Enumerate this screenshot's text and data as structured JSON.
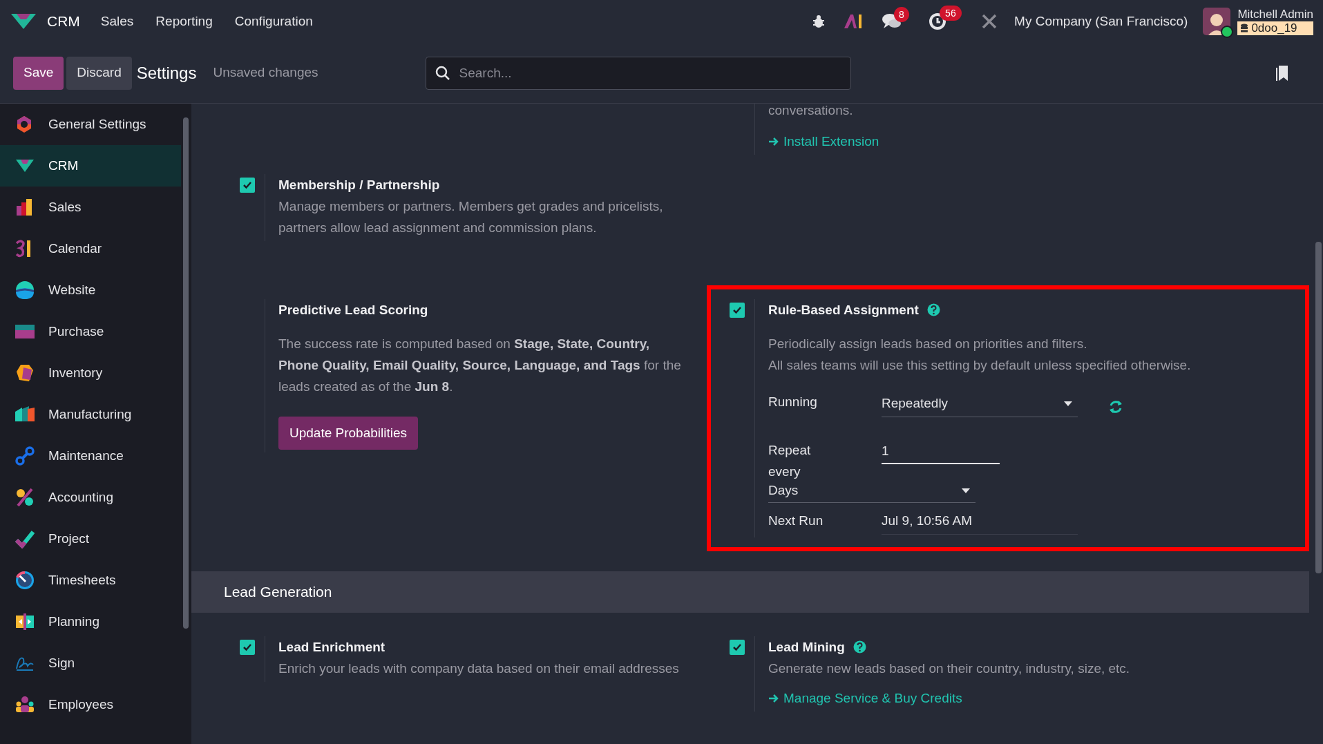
{
  "navbar": {
    "app_name": "CRM",
    "menus": [
      "Sales",
      "Reporting",
      "Configuration"
    ],
    "messages_count": "8",
    "activities_count": "56",
    "company": "My Company (San Francisco)",
    "user_name": "Mitchell Admin",
    "database": "0doo_19"
  },
  "control_panel": {
    "buttons": [
      "Save",
      "Discard"
    ],
    "title": "Settings",
    "status": "Unsaved changes",
    "search": {
      "placeholder": "Search..."
    }
  },
  "sidebar": {
    "items": [
      {
        "label": "General Settings",
        "selected": false
      },
      {
        "label": "CRM",
        "selected": true
      },
      {
        "label": "Sales",
        "selected": false
      },
      {
        "label": "Calendar",
        "selected": false
      },
      {
        "label": "Website",
        "selected": false
      },
      {
        "label": "Purchase",
        "selected": false
      },
      {
        "label": "Inventory",
        "selected": false
      },
      {
        "label": "Manufacturing",
        "selected": false
      },
      {
        "label": "Maintenance",
        "selected": false
      },
      {
        "label": "Accounting",
        "selected": false
      },
      {
        "label": "Project",
        "selected": false
      },
      {
        "label": "Timesheets",
        "selected": false
      },
      {
        "label": "Planning",
        "selected": false
      },
      {
        "label": "Sign",
        "selected": false
      },
      {
        "label": "Employees",
        "selected": false
      }
    ]
  },
  "sections": [
    {
      "rows": [
        {
          "right": {
            "description": [
              "conversations."
            ],
            "link": "Install Extension",
            "highlighted": false
          }
        },
        {
          "left": {
            "title": "Membership / Partnership",
            "checked": true,
            "help": false,
            "highlighted": false,
            "description": [
              "Manage members or partners. Members get grades and pricelists, partners allow lead assignment and commission plans."
            ]
          }
        },
        {
          "left": {
            "title": "Predictive Lead Scoring",
            "help": false,
            "highlighted": false,
            "description": [
              "The success rate is computed based on **Stage, State, Country, Phone Quality, Email Quality, Source, Language, and Tags** for the leads created as of the **Jun 8**."
            ],
            "button": "Update Probabilities"
          },
          "right": {
            "title": "Rule-Based Assignment",
            "checked": true,
            "help": true,
            "highlighted": true,
            "description": [
              "Periodically assign leads based on priorities and filters.",
              "All sales teams will use this setting by default unless specified otherwise."
            ],
            "fields": [
              {
                "kind": "select",
                "label": "Running",
                "value": "Repeatedly",
                "refresh": true
              },
              {
                "kind": "interval",
                "label": "Repeat every",
                "value": "1",
                "unit": "Days"
              },
              {
                "kind": "readonly",
                "label": "Next Run",
                "value": "Jul 9, 10:56 AM"
              }
            ]
          }
        }
      ]
    },
    {
      "title": "Lead Generation",
      "rows": [
        {
          "left": {
            "title": "Lead Enrichment",
            "checked": true,
            "help": false,
            "highlighted": false,
            "description": [
              "Enrich your leads with company data based on their email addresses"
            ]
          },
          "right": {
            "title": "Lead Mining",
            "checked": true,
            "help": true,
            "highlighted": false,
            "description": [
              "Generate new leads based on their country, industry, size, etc."
            ],
            "link": "Manage Service & Buy Credits"
          }
        }
      ]
    }
  ]
}
